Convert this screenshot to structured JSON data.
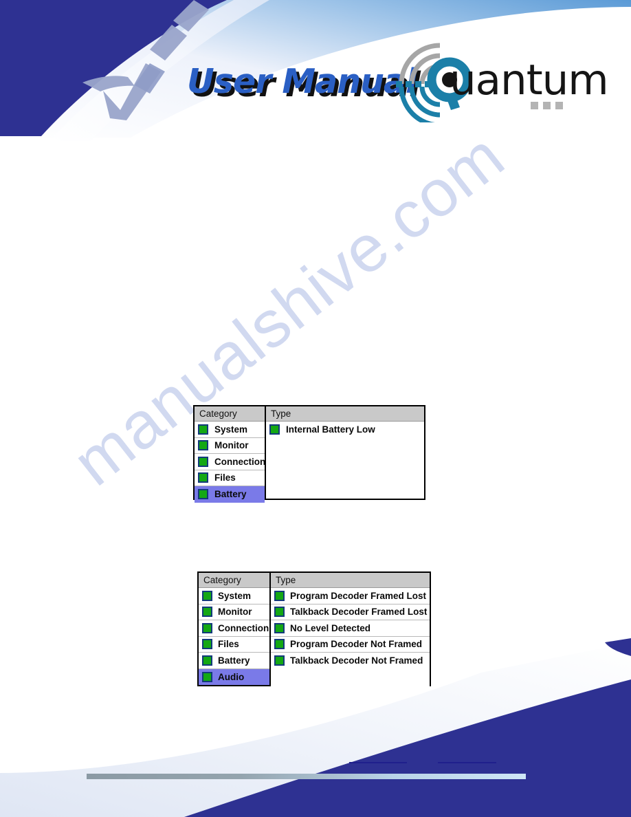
{
  "header": {
    "title": "User Manual",
    "logo_word": "uantum",
    "logo_letter": "Q",
    "brand_color": "#1b7fa8",
    "title_color": "#2a5fc4",
    "band_color": "#2e3192"
  },
  "watermark": {
    "text": "manualshive.com",
    "color": "#c9d3ee"
  },
  "tables": [
    {
      "name": "battery-alarm-table",
      "columns": [
        "Category",
        "Type"
      ],
      "categories": [
        {
          "label": "System",
          "selected": false,
          "led": "green"
        },
        {
          "label": "Monitor",
          "selected": false,
          "led": "green"
        },
        {
          "label": "Connection",
          "selected": false,
          "led": "green"
        },
        {
          "label": "Files",
          "selected": false,
          "led": "green"
        },
        {
          "label": "Battery",
          "selected": true,
          "led": "green"
        }
      ],
      "types": [
        {
          "label": "Internal Battery Low",
          "led": "green"
        }
      ]
    },
    {
      "name": "audio-alarm-table",
      "columns": [
        "Category",
        "Type"
      ],
      "categories": [
        {
          "label": "System",
          "selected": false,
          "led": "green"
        },
        {
          "label": "Monitor",
          "selected": false,
          "led": "green"
        },
        {
          "label": "Connection",
          "selected": false,
          "led": "green"
        },
        {
          "label": "Files",
          "selected": false,
          "led": "green"
        },
        {
          "label": "Battery",
          "selected": false,
          "led": "green"
        },
        {
          "label": "Audio",
          "selected": true,
          "led": "green"
        }
      ],
      "types": [
        {
          "label": "Program Decoder Framed Lost",
          "led": "green"
        },
        {
          "label": "Talkback Decoder Framed Lost",
          "led": "green"
        },
        {
          "label": "No Level Detected",
          "led": "green"
        },
        {
          "label": "Program Decoder Not Framed",
          "led": "green"
        },
        {
          "label": "Talkback Decoder Not Framed",
          "led": "green"
        }
      ]
    }
  ],
  "colors": {
    "led_green": "#14a814",
    "led_border": "#123a7a",
    "row_selected": "#7a7ae8",
    "header_bg": "#c9c9c9",
    "navy": "#2e3192",
    "footer_rule": "#1f1f8c"
  }
}
